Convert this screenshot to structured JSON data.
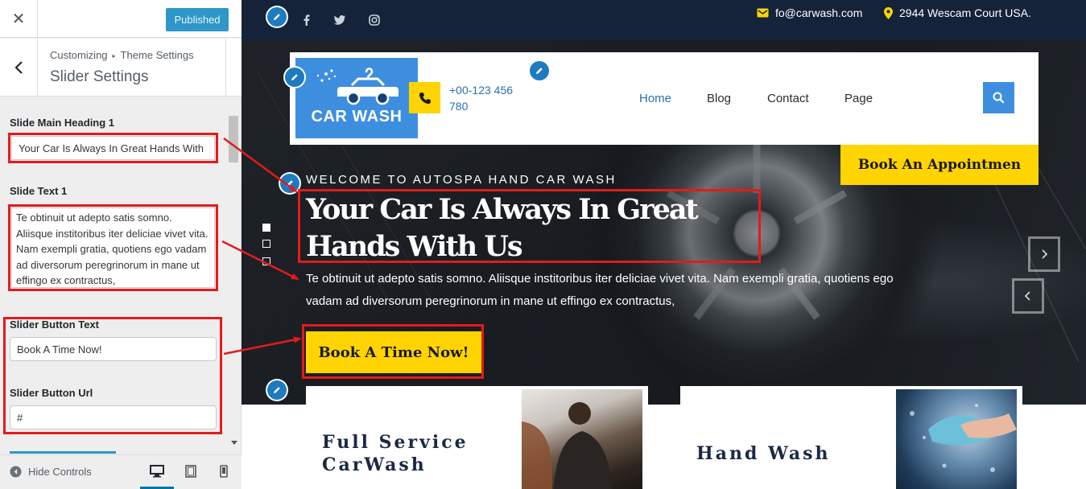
{
  "customizer": {
    "close_label": "✕",
    "published_label": "Published",
    "breadcrumb_root": "Customizing",
    "breadcrumb_sep": "▸",
    "breadcrumb_section": "Theme Settings",
    "section_title": "Slider Settings",
    "fields": {
      "heading_label": "Slide Main Heading 1",
      "heading_value": "Your Car Is Always In Great Hands With",
      "text_label": "Slide Text 1",
      "text_value": "Te obtinuit ut adepto satis somno. Aliisque institoribus iter deliciae vivet vita. Nam exempli gratia, quotiens ego vadam ad diversorum peregrinorum in mane ut effingo ex contractus,",
      "button_text_label": "Slider Button Text",
      "button_text_value": "Book A Time Now!",
      "button_url_label": "Slider Button Url",
      "button_url_value": "#"
    },
    "footer": {
      "hide_controls": "Hide Controls"
    }
  },
  "site": {
    "email": "fo@carwash.com",
    "address": "2944 Wescam Court USA.",
    "social_icons": [
      "facebook-icon",
      "twitter-icon",
      "instagram-icon"
    ],
    "logo_text": "CAR WASH",
    "phone": "+00-123 456 780",
    "nav": [
      "Home",
      "Blog",
      "Contact",
      "Page"
    ],
    "nav_active": "Home",
    "appointment_button": "Book An Appointmen",
    "hero": {
      "welcome": "WELCOME TO AUTOSPA HAND CAR WASH",
      "heading": "Your Car Is Always In Great Hands With Us",
      "text": "Te obtinuit ut adepto satis somno. Aliisque institoribus iter deliciae vivet vita. Nam exempli gratia, quotiens ego vadam ad diversorum peregrinorum in mane ut effingo ex contractus,",
      "button": "Book A Time Now!"
    },
    "services": [
      {
        "title_line1": "Full Service",
        "title_line2": "CarWash"
      },
      {
        "title_line1": "Hand Wash",
        "title_line2": ""
      }
    ]
  },
  "colors": {
    "accent_blue": "#3e8ee0",
    "accent_yellow": "#ffd400",
    "topbar_navy": "#142339",
    "annotation_red": "#e31b1b",
    "published_blue": "#2f96c8"
  }
}
